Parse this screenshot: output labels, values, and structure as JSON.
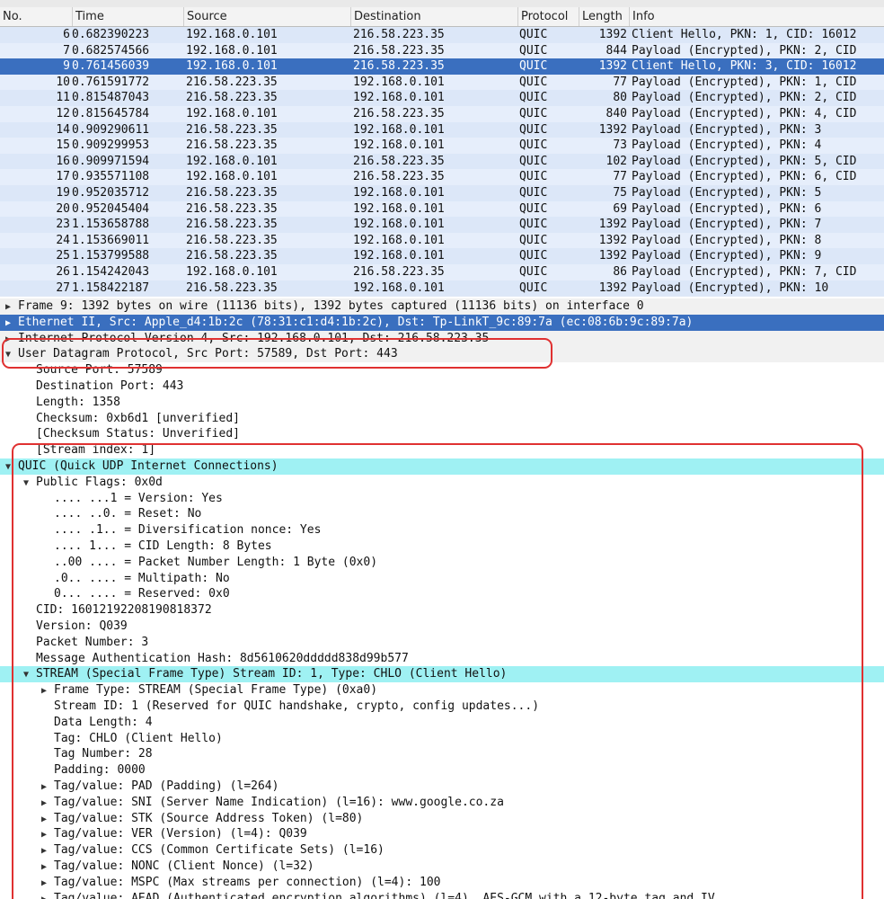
{
  "packet_list": {
    "columns": [
      "No.",
      "Time",
      "Source",
      "Destination",
      "Protocol",
      "Length",
      "Info"
    ],
    "selected_index": 2,
    "rows": [
      {
        "no": "6",
        "time": "0.682390223",
        "src": "192.168.0.101",
        "dst": "216.58.223.35",
        "proto": "QUIC",
        "len": "1392",
        "info": "Client Hello, PKN: 1, CID: 16012"
      },
      {
        "no": "7",
        "time": "0.682574566",
        "src": "192.168.0.101",
        "dst": "216.58.223.35",
        "proto": "QUIC",
        "len": "844",
        "info": "Payload (Encrypted), PKN: 2, CID"
      },
      {
        "no": "9",
        "time": "0.761456039",
        "src": "192.168.0.101",
        "dst": "216.58.223.35",
        "proto": "QUIC",
        "len": "1392",
        "info": "Client Hello, PKN: 3, CID: 16012"
      },
      {
        "no": "10",
        "time": "0.761591772",
        "src": "216.58.223.35",
        "dst": "192.168.0.101",
        "proto": "QUIC",
        "len": "77",
        "info": "Payload (Encrypted), PKN: 1, CID"
      },
      {
        "no": "11",
        "time": "0.815487043",
        "src": "216.58.223.35",
        "dst": "192.168.0.101",
        "proto": "QUIC",
        "len": "80",
        "info": "Payload (Encrypted), PKN: 2, CID"
      },
      {
        "no": "12",
        "time": "0.815645784",
        "src": "192.168.0.101",
        "dst": "216.58.223.35",
        "proto": "QUIC",
        "len": "840",
        "info": "Payload (Encrypted), PKN: 4, CID"
      },
      {
        "no": "14",
        "time": "0.909290611",
        "src": "216.58.223.35",
        "dst": "192.168.0.101",
        "proto": "QUIC",
        "len": "1392",
        "info": "Payload (Encrypted), PKN: 3"
      },
      {
        "no": "15",
        "time": "0.909299953",
        "src": "216.58.223.35",
        "dst": "192.168.0.101",
        "proto": "QUIC",
        "len": "73",
        "info": "Payload (Encrypted), PKN: 4"
      },
      {
        "no": "16",
        "time": "0.909971594",
        "src": "192.168.0.101",
        "dst": "216.58.223.35",
        "proto": "QUIC",
        "len": "102",
        "info": "Payload (Encrypted), PKN: 5, CID"
      },
      {
        "no": "17",
        "time": "0.935571108",
        "src": "192.168.0.101",
        "dst": "216.58.223.35",
        "proto": "QUIC",
        "len": "77",
        "info": "Payload (Encrypted), PKN: 6, CID"
      },
      {
        "no": "19",
        "time": "0.952035712",
        "src": "216.58.223.35",
        "dst": "192.168.0.101",
        "proto": "QUIC",
        "len": "75",
        "info": "Payload (Encrypted), PKN: 5"
      },
      {
        "no": "20",
        "time": "0.952045404",
        "src": "216.58.223.35",
        "dst": "192.168.0.101",
        "proto": "QUIC",
        "len": "69",
        "info": "Payload (Encrypted), PKN: 6"
      },
      {
        "no": "23",
        "time": "1.153658788",
        "src": "216.58.223.35",
        "dst": "192.168.0.101",
        "proto": "QUIC",
        "len": "1392",
        "info": "Payload (Encrypted), PKN: 7"
      },
      {
        "no": "24",
        "time": "1.153669011",
        "src": "216.58.223.35",
        "dst": "192.168.0.101",
        "proto": "QUIC",
        "len": "1392",
        "info": "Payload (Encrypted), PKN: 8"
      },
      {
        "no": "25",
        "time": "1.153799588",
        "src": "216.58.223.35",
        "dst": "192.168.0.101",
        "proto": "QUIC",
        "len": "1392",
        "info": "Payload (Encrypted), PKN: 9"
      },
      {
        "no": "26",
        "time": "1.154242043",
        "src": "192.168.0.101",
        "dst": "216.58.223.35",
        "proto": "QUIC",
        "len": "86",
        "info": "Payload (Encrypted), PKN: 7, CID"
      },
      {
        "no": "27",
        "time": "1.158422187",
        "src": "216.58.223.35",
        "dst": "192.168.0.101",
        "proto": "QUIC",
        "len": "1392",
        "info": "Payload (Encrypted), PKN: 10"
      }
    ]
  },
  "details": {
    "lines": [
      {
        "indent": 0,
        "arrow": "collapsed",
        "text": "Frame 9: 1392 bytes on wire (11136 bits), 1392 bytes captured (11136 bits) on interface 0",
        "style": "grey"
      },
      {
        "indent": 0,
        "arrow": "collapsed",
        "text": "Ethernet II, Src: Apple_d4:1b:2c (78:31:c1:d4:1b:2c), Dst: Tp-LinkT_9c:89:7a (ec:08:6b:9c:89:7a)",
        "style": "sel-blue"
      },
      {
        "indent": 0,
        "arrow": "collapsed",
        "text": "Internet Protocol Version 4, Src: 192.168.0.101, Dst: 216.58.223.35",
        "style": "grey"
      },
      {
        "indent": 0,
        "arrow": "expanded",
        "text": "User Datagram Protocol, Src Port: 57589, Dst Port: 443",
        "style": "grey"
      },
      {
        "indent": 1,
        "arrow": "none",
        "text": "Source Port: 57589",
        "style": ""
      },
      {
        "indent": 1,
        "arrow": "none",
        "text": "Destination Port: 443",
        "style": ""
      },
      {
        "indent": 1,
        "arrow": "none",
        "text": "Length: 1358",
        "style": ""
      },
      {
        "indent": 1,
        "arrow": "none",
        "text": "Checksum: 0xb6d1 [unverified]",
        "style": ""
      },
      {
        "indent": 1,
        "arrow": "none",
        "text": "[Checksum Status: Unverified]",
        "style": ""
      },
      {
        "indent": 1,
        "arrow": "none",
        "text": "[Stream index: 1]",
        "style": ""
      },
      {
        "indent": 0,
        "arrow": "expanded",
        "text": "QUIC (Quick UDP Internet Connections)",
        "style": "hl-cyan"
      },
      {
        "indent": 1,
        "arrow": "expanded",
        "text": "Public Flags: 0x0d",
        "style": ""
      },
      {
        "indent": 2,
        "arrow": "none",
        "text": ".... ...1 = Version: Yes",
        "style": ""
      },
      {
        "indent": 2,
        "arrow": "none",
        "text": ".... ..0. = Reset: No",
        "style": ""
      },
      {
        "indent": 2,
        "arrow": "none",
        "text": ".... .1.. = Diversification nonce: Yes",
        "style": ""
      },
      {
        "indent": 2,
        "arrow": "none",
        "text": ".... 1... = CID Length: 8 Bytes",
        "style": ""
      },
      {
        "indent": 2,
        "arrow": "none",
        "text": "..00 .... = Packet Number Length: 1 Byte (0x0)",
        "style": ""
      },
      {
        "indent": 2,
        "arrow": "none",
        "text": ".0.. .... = Multipath: No",
        "style": ""
      },
      {
        "indent": 2,
        "arrow": "none",
        "text": "0... .... = Reserved: 0x0",
        "style": ""
      },
      {
        "indent": 1,
        "arrow": "none",
        "text": "CID: 16012192208190818372",
        "style": ""
      },
      {
        "indent": 1,
        "arrow": "none",
        "text": "Version: Q039",
        "style": ""
      },
      {
        "indent": 1,
        "arrow": "none",
        "text": "Packet Number: 3",
        "style": ""
      },
      {
        "indent": 1,
        "arrow": "none",
        "text": "Message Authentication Hash: 8d5610620ddddd838d99b577",
        "style": ""
      },
      {
        "indent": 1,
        "arrow": "expanded",
        "text": "STREAM (Special Frame Type) Stream ID: 1, Type: CHLO (Client Hello)",
        "style": "hl-cyan"
      },
      {
        "indent": 2,
        "arrow": "collapsed",
        "text": "Frame Type: STREAM (Special Frame Type) (0xa0)",
        "style": ""
      },
      {
        "indent": 2,
        "arrow": "none",
        "text": "Stream ID: 1 (Reserved for QUIC handshake, crypto, config updates...)",
        "style": ""
      },
      {
        "indent": 2,
        "arrow": "none",
        "text": "Data Length: 4",
        "style": ""
      },
      {
        "indent": 2,
        "arrow": "none",
        "text": "Tag: CHLO (Client Hello)",
        "style": ""
      },
      {
        "indent": 2,
        "arrow": "none",
        "text": "Tag Number: 28",
        "style": ""
      },
      {
        "indent": 2,
        "arrow": "none",
        "text": "Padding: 0000",
        "style": ""
      },
      {
        "indent": 2,
        "arrow": "collapsed",
        "text": "Tag/value: PAD (Padding) (l=264)",
        "style": ""
      },
      {
        "indent": 2,
        "arrow": "collapsed",
        "text": "Tag/value: SNI (Server Name Indication) (l=16): www.google.co.za",
        "style": ""
      },
      {
        "indent": 2,
        "arrow": "collapsed",
        "text": "Tag/value: STK (Source Address Token) (l=80)",
        "style": ""
      },
      {
        "indent": 2,
        "arrow": "collapsed",
        "text": "Tag/value: VER (Version) (l=4): Q039",
        "style": ""
      },
      {
        "indent": 2,
        "arrow": "collapsed",
        "text": "Tag/value: CCS (Common Certificate Sets) (l=16)",
        "style": ""
      },
      {
        "indent": 2,
        "arrow": "collapsed",
        "text": "Tag/value: NONC (Client Nonce) (l=32)",
        "style": ""
      },
      {
        "indent": 2,
        "arrow": "collapsed",
        "text": "Tag/value: MSPC (Max streams per connection) (l=4): 100",
        "style": ""
      },
      {
        "indent": 2,
        "arrow": "collapsed",
        "text": "Tag/value: AEAD (Authenticated encryption algorithms) (l=4), AES-GCM with a 12-byte tag and IV",
        "style": ""
      }
    ]
  },
  "icons": {
    "expanded": "arrow-down-icon",
    "collapsed": "arrow-right-icon"
  },
  "colors": {
    "selected": "#3a6fbf",
    "highlight": "#9ff1f3",
    "annotation": "#e03131"
  }
}
